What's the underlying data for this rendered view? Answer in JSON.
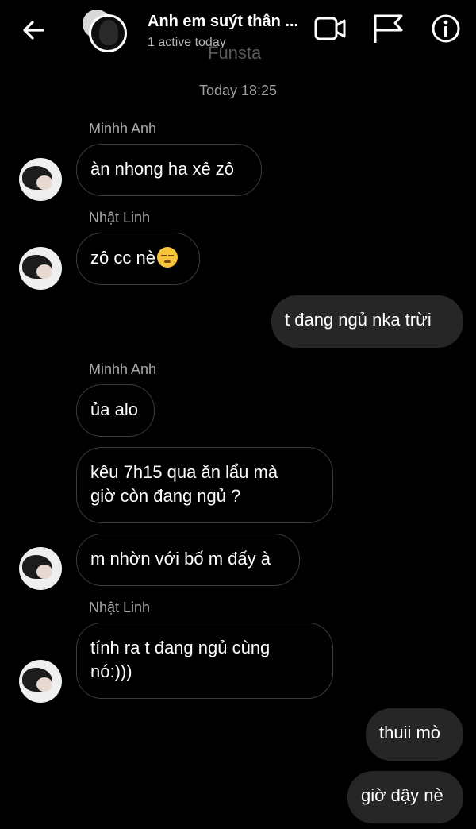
{
  "header": {
    "title": "Anh em suýt thân ...",
    "subtitle": "1 active today",
    "watermark": "Funsta",
    "icons": [
      "back-arrow-icon",
      "video-call-icon",
      "flag-icon",
      "info-icon"
    ]
  },
  "chat": {
    "timestamp": "Today 18:25",
    "messages": [
      {
        "sender": "Minhh Anh",
        "text": "àn nhong ha xê zô",
        "direction": "incoming"
      },
      {
        "sender": "Nhật Linh",
        "text": "zô cc nè",
        "emoji": "pensive-face-emoji",
        "direction": "incoming"
      },
      {
        "text": "t đang ngủ nka trừi",
        "direction": "outgoing"
      },
      {
        "sender": "Minhh Anh",
        "text": "ủa alo",
        "direction": "incoming"
      },
      {
        "text": "kêu 7h15 qua ăn lẩu mà",
        "text2": "giờ còn đang ngủ ?",
        "direction": "incoming"
      },
      {
        "text": "m nhờn với bố m đấy à",
        "direction": "incoming"
      },
      {
        "sender": "Nhật Linh",
        "text": "tính ra t đang ngủ cùng",
        "text2": "nó:)))",
        "direction": "incoming"
      },
      {
        "text": "thuii mò",
        "direction": "outgoing"
      },
      {
        "text": "giờ dậy nè",
        "direction": "outgoing"
      }
    ]
  },
  "colors": {
    "background": "#000000",
    "outgoing_bubble": "#262626",
    "incoming_border": "#3a3a3a"
  }
}
